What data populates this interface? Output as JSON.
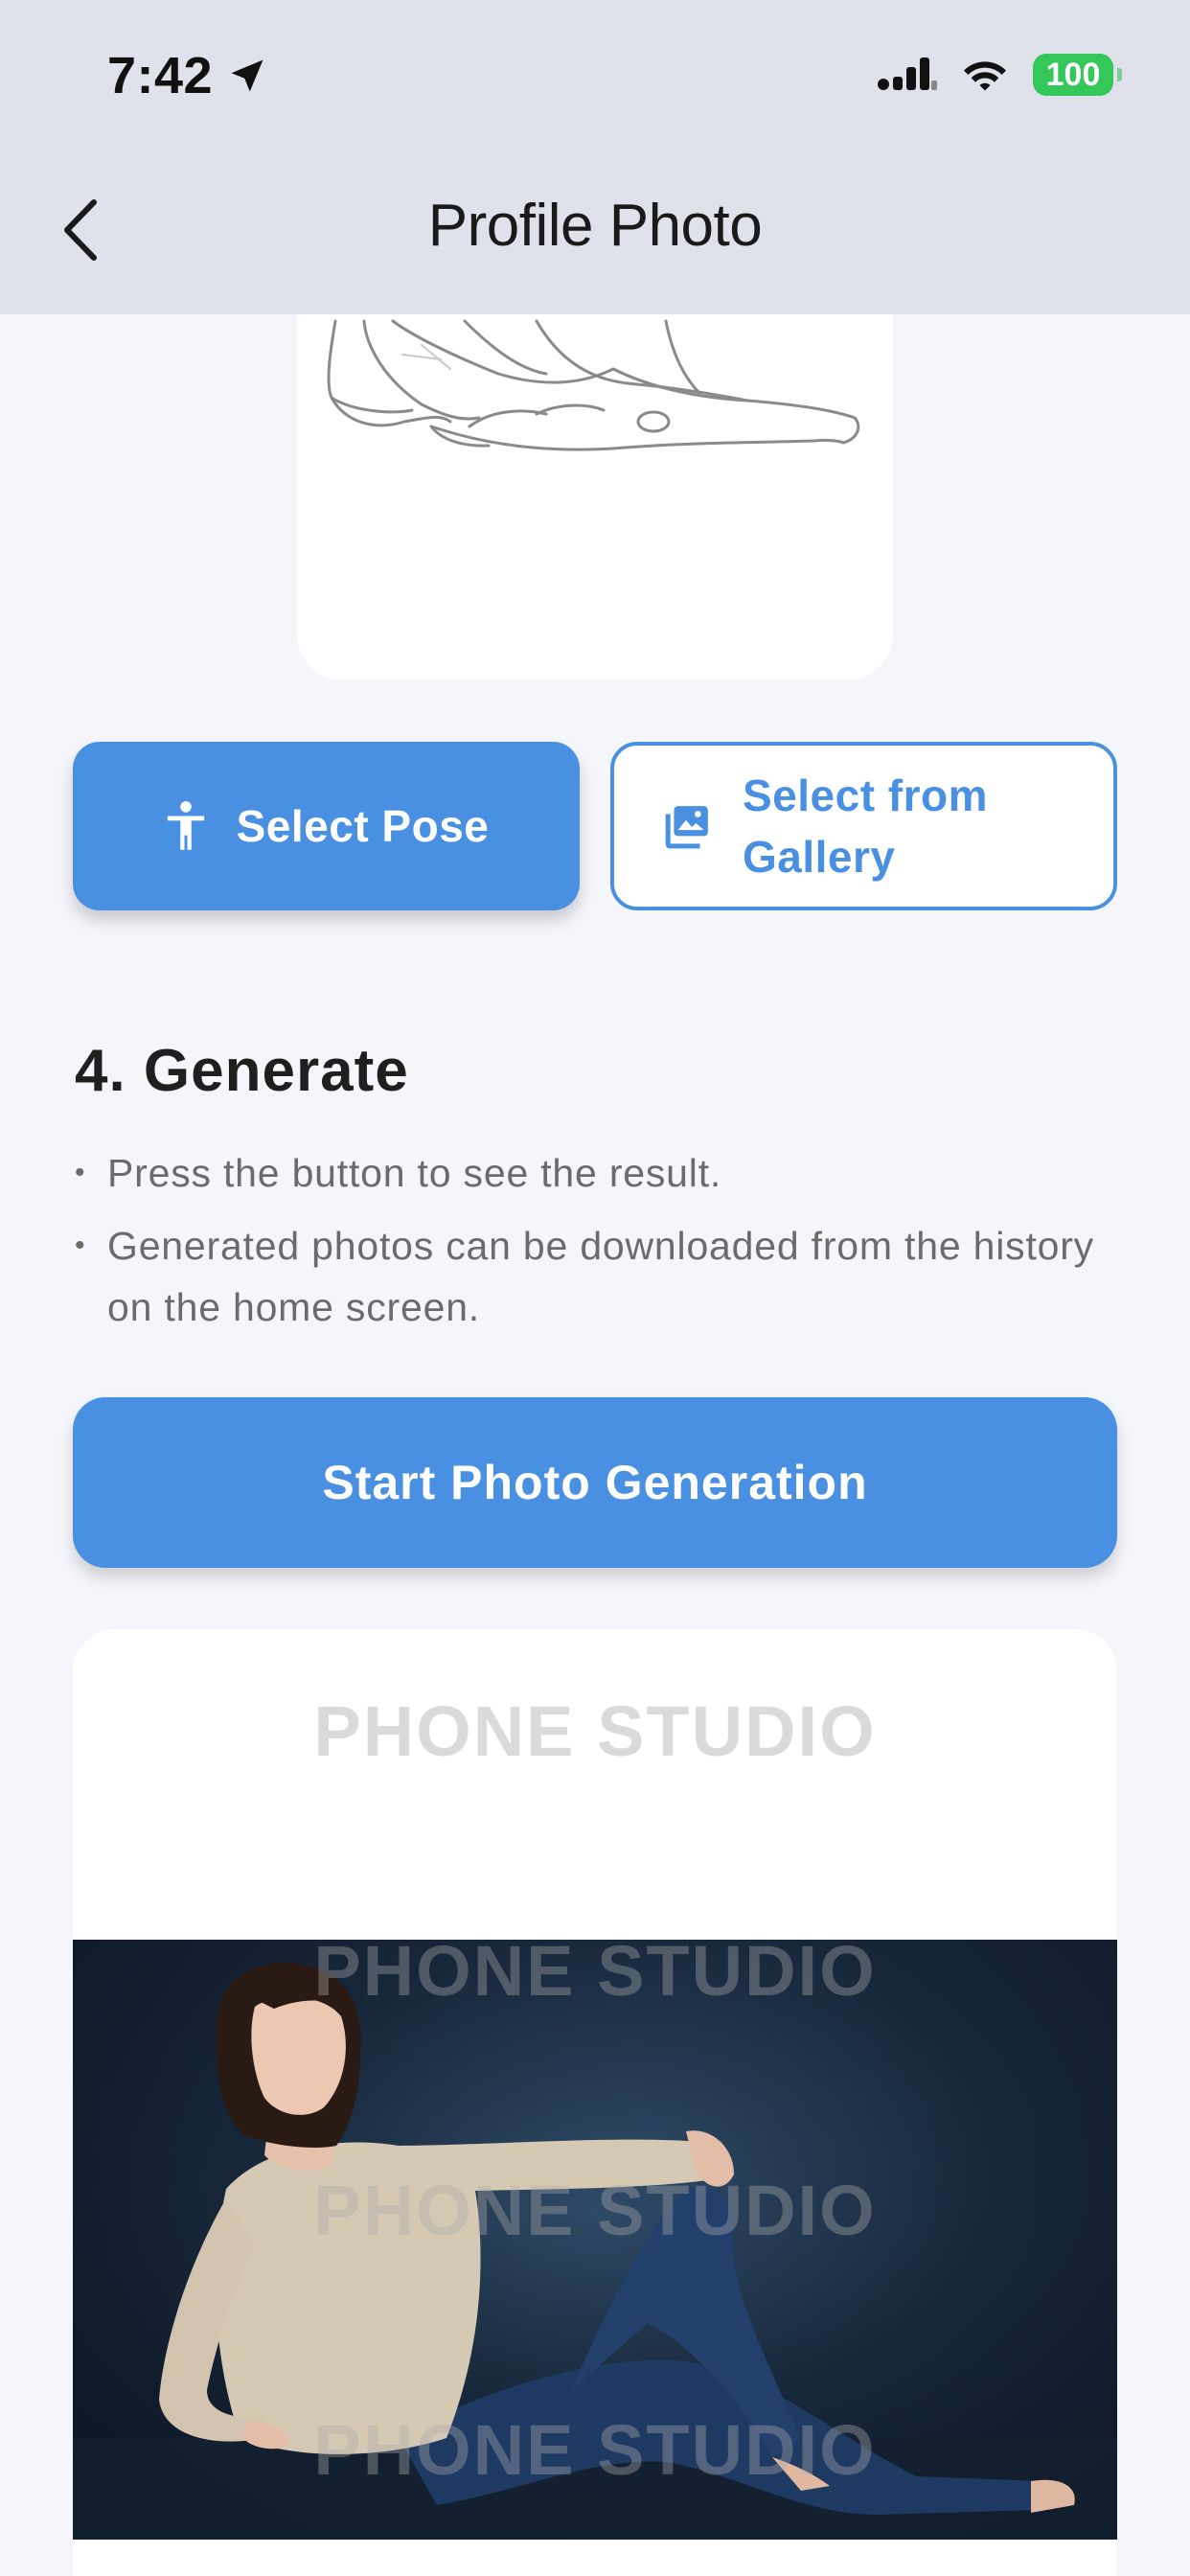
{
  "status_bar": {
    "time": "7:42",
    "battery": "100",
    "icons": [
      "location-arrow-icon",
      "cellular-signal-icon",
      "wifi-icon",
      "battery-icon"
    ]
  },
  "nav": {
    "title": "Profile Photo",
    "back_icon": "chevron-left-icon"
  },
  "pose_section": {
    "pose_image": "pose-sketch-reclining-figure",
    "select_pose_label": "Select Pose",
    "select_pose_icon": "accessibility-person-icon",
    "select_gallery_label": "Select from Gallery",
    "select_gallery_icon": "photo-icon"
  },
  "generate_section": {
    "title": "4. Generate",
    "bullets": [
      "Press the button to see the result.",
      "Generated photos can be downloaded from the history on the home screen."
    ],
    "start_button_label": "Start Photo Generation"
  },
  "result": {
    "watermark": "PHONE STUDIO",
    "photo": "woman-reclining-studio-portrait"
  },
  "colors": {
    "accent": "#4a90e2",
    "topbar_bg": "#dfe2ea",
    "page_bg": "#f5f6fb",
    "battery": "#34c759"
  }
}
